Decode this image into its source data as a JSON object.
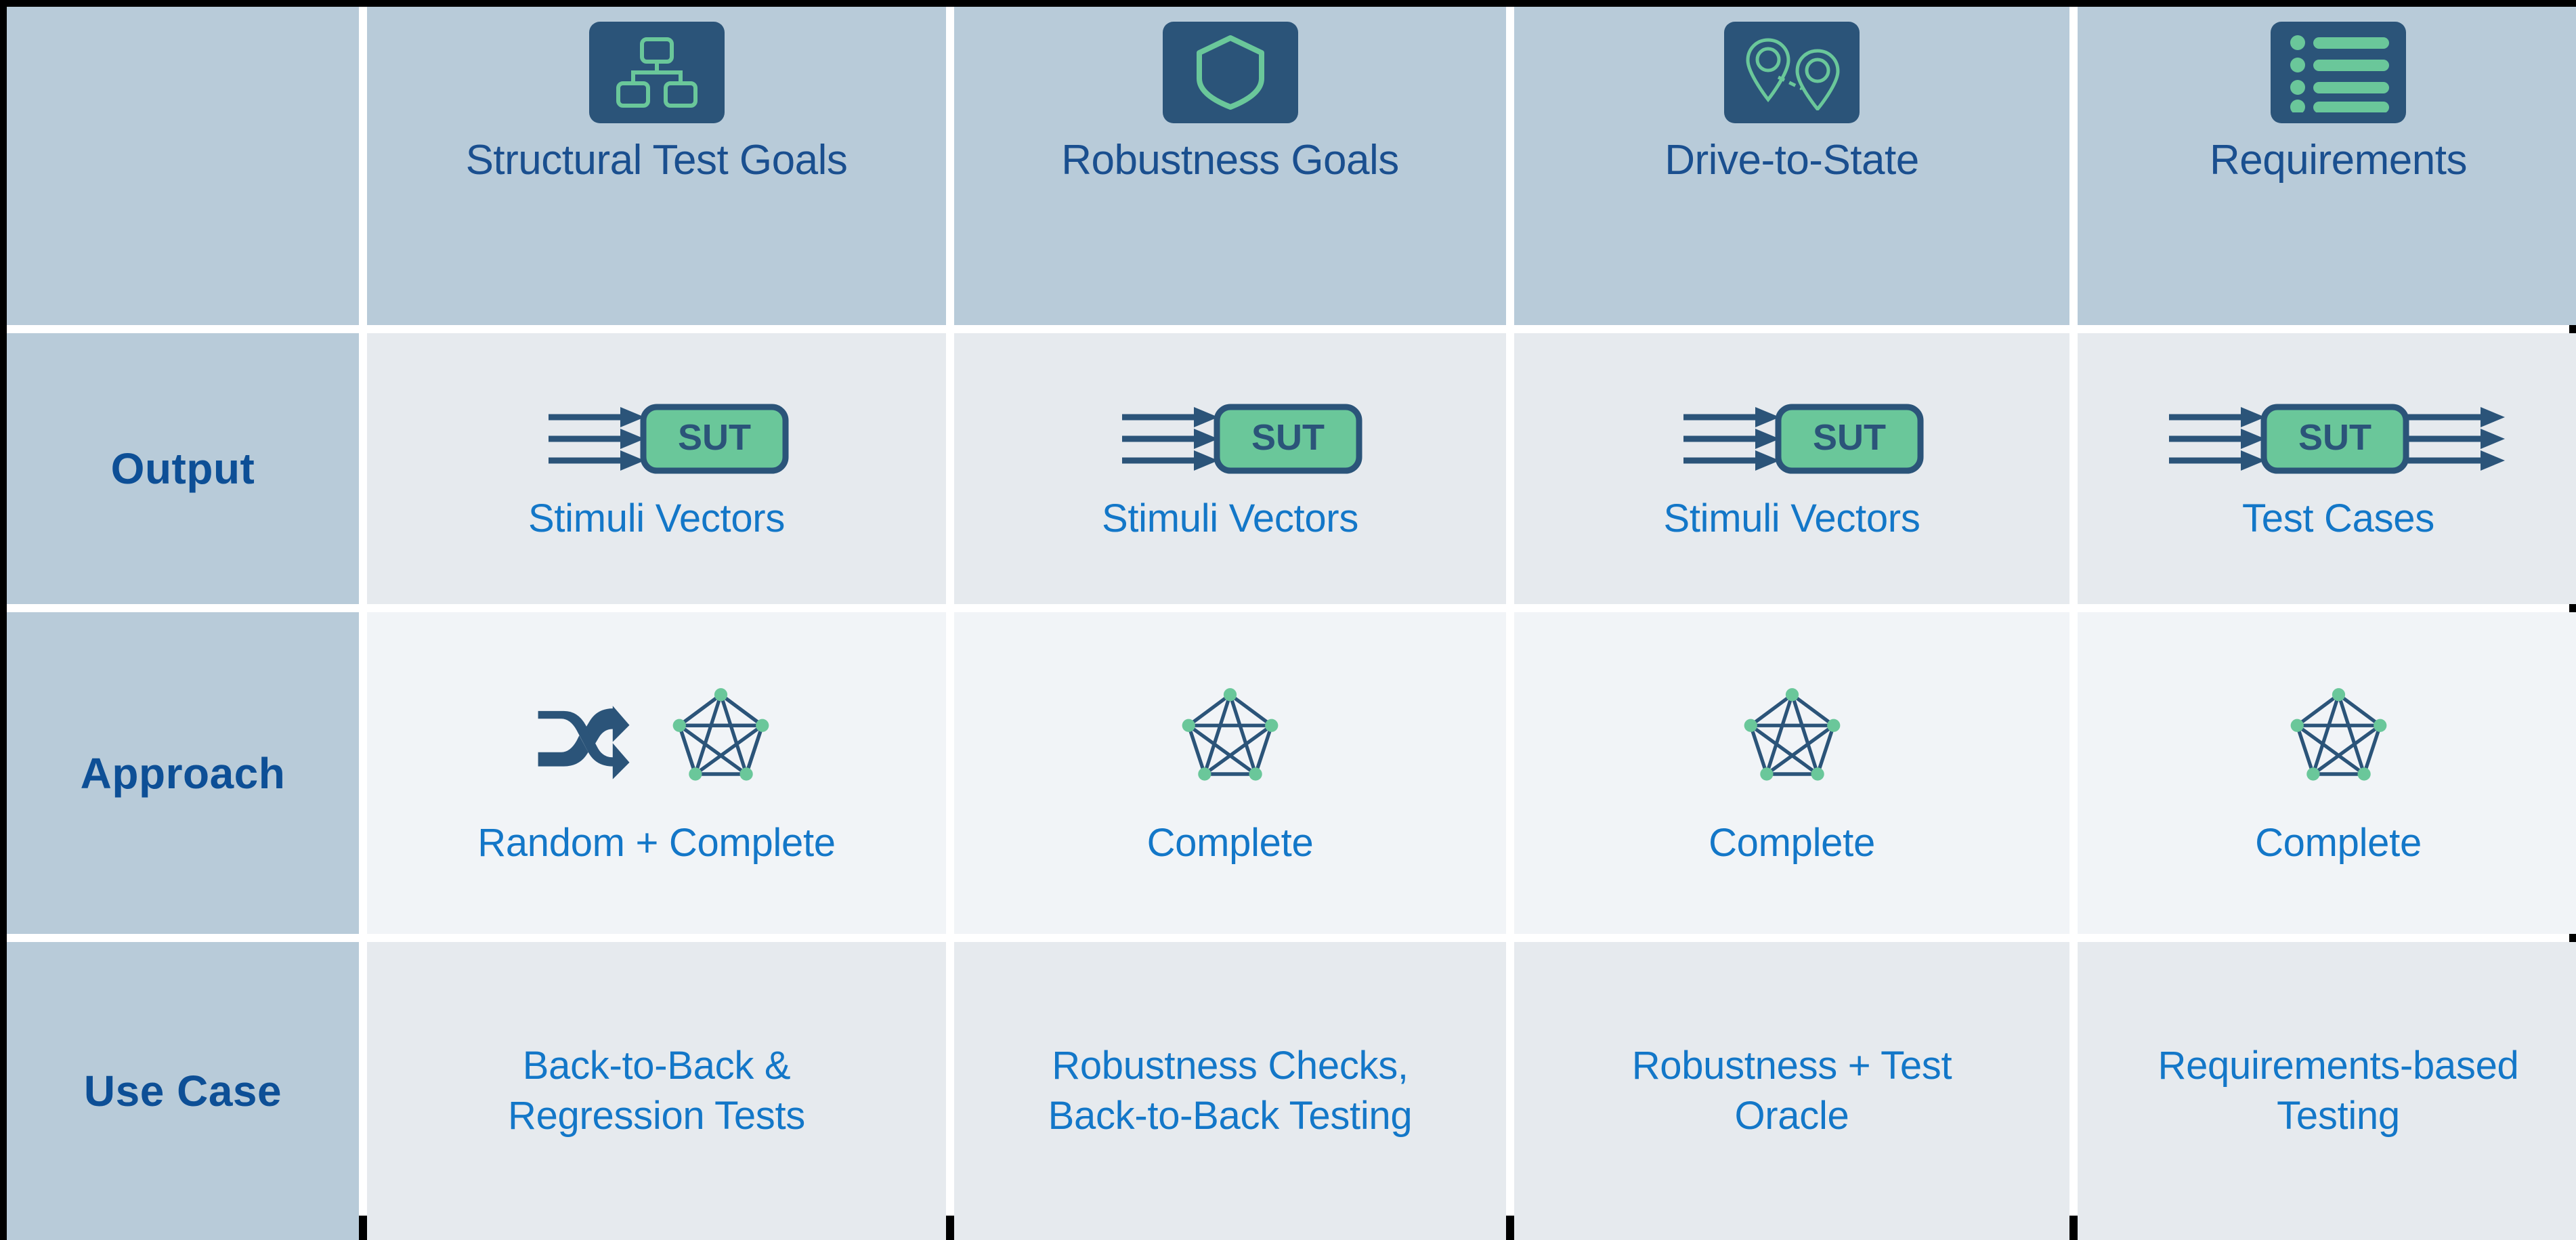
{
  "matrix": {
    "corner_label": "",
    "row_labels": [
      "Output",
      "Approach",
      "Use Case"
    ],
    "columns": [
      {
        "header": "Structural Test Goals",
        "header_icon": "hierarchy-icon",
        "output_icon": "sut-block-icon",
        "output_caption": "Stimuli Vectors",
        "approach_icons": [
          "shuffle-icon",
          "complete-graph-icon"
        ],
        "approach_caption": "Random + Complete",
        "use_case_caption": "Back-to-Back &\nRegression Tests"
      },
      {
        "header": "Robustness Goals",
        "header_icon": "shield-icon",
        "output_icon": "sut-block-icon",
        "output_caption": "Stimuli Vectors",
        "approach_icons": [
          "complete-graph-icon"
        ],
        "approach_caption": "Complete",
        "use_case_caption": "Robustness Checks,\nBack-to-Back Testing"
      },
      {
        "header": "Drive-to-State",
        "header_icon": "route-pins-icon",
        "output_icon": "sut-block-icon",
        "output_caption": "Stimuli Vectors",
        "approach_icons": [
          "complete-graph-icon"
        ],
        "approach_caption": "Complete",
        "use_case_caption": "Robustness + Test\nOracle"
      },
      {
        "header": "Requirements",
        "header_icon": "bullet-list-icon",
        "output_icon": "sut-block-io-icon",
        "output_caption": "Test Cases",
        "approach_icons": [
          "complete-graph-icon"
        ],
        "approach_caption": "Complete",
        "use_case_caption": "Requirements-based\nTesting"
      }
    ],
    "sut_label": "SUT",
    "colors": {
      "header_bg": "#b8cbd9",
      "row_bg_a": "#e6eaee",
      "row_bg_b": "#f1f4f7",
      "icon_tile_bg": "#2b5479",
      "icon_accent": "#6ac79a",
      "header_text": "#1a4f8f",
      "row_label_text": "#0d4f96",
      "caption_text": "#1377c8",
      "sut_fill": "#6ac79a",
      "sut_stroke": "#2b5479",
      "frame": "#000000"
    }
  }
}
